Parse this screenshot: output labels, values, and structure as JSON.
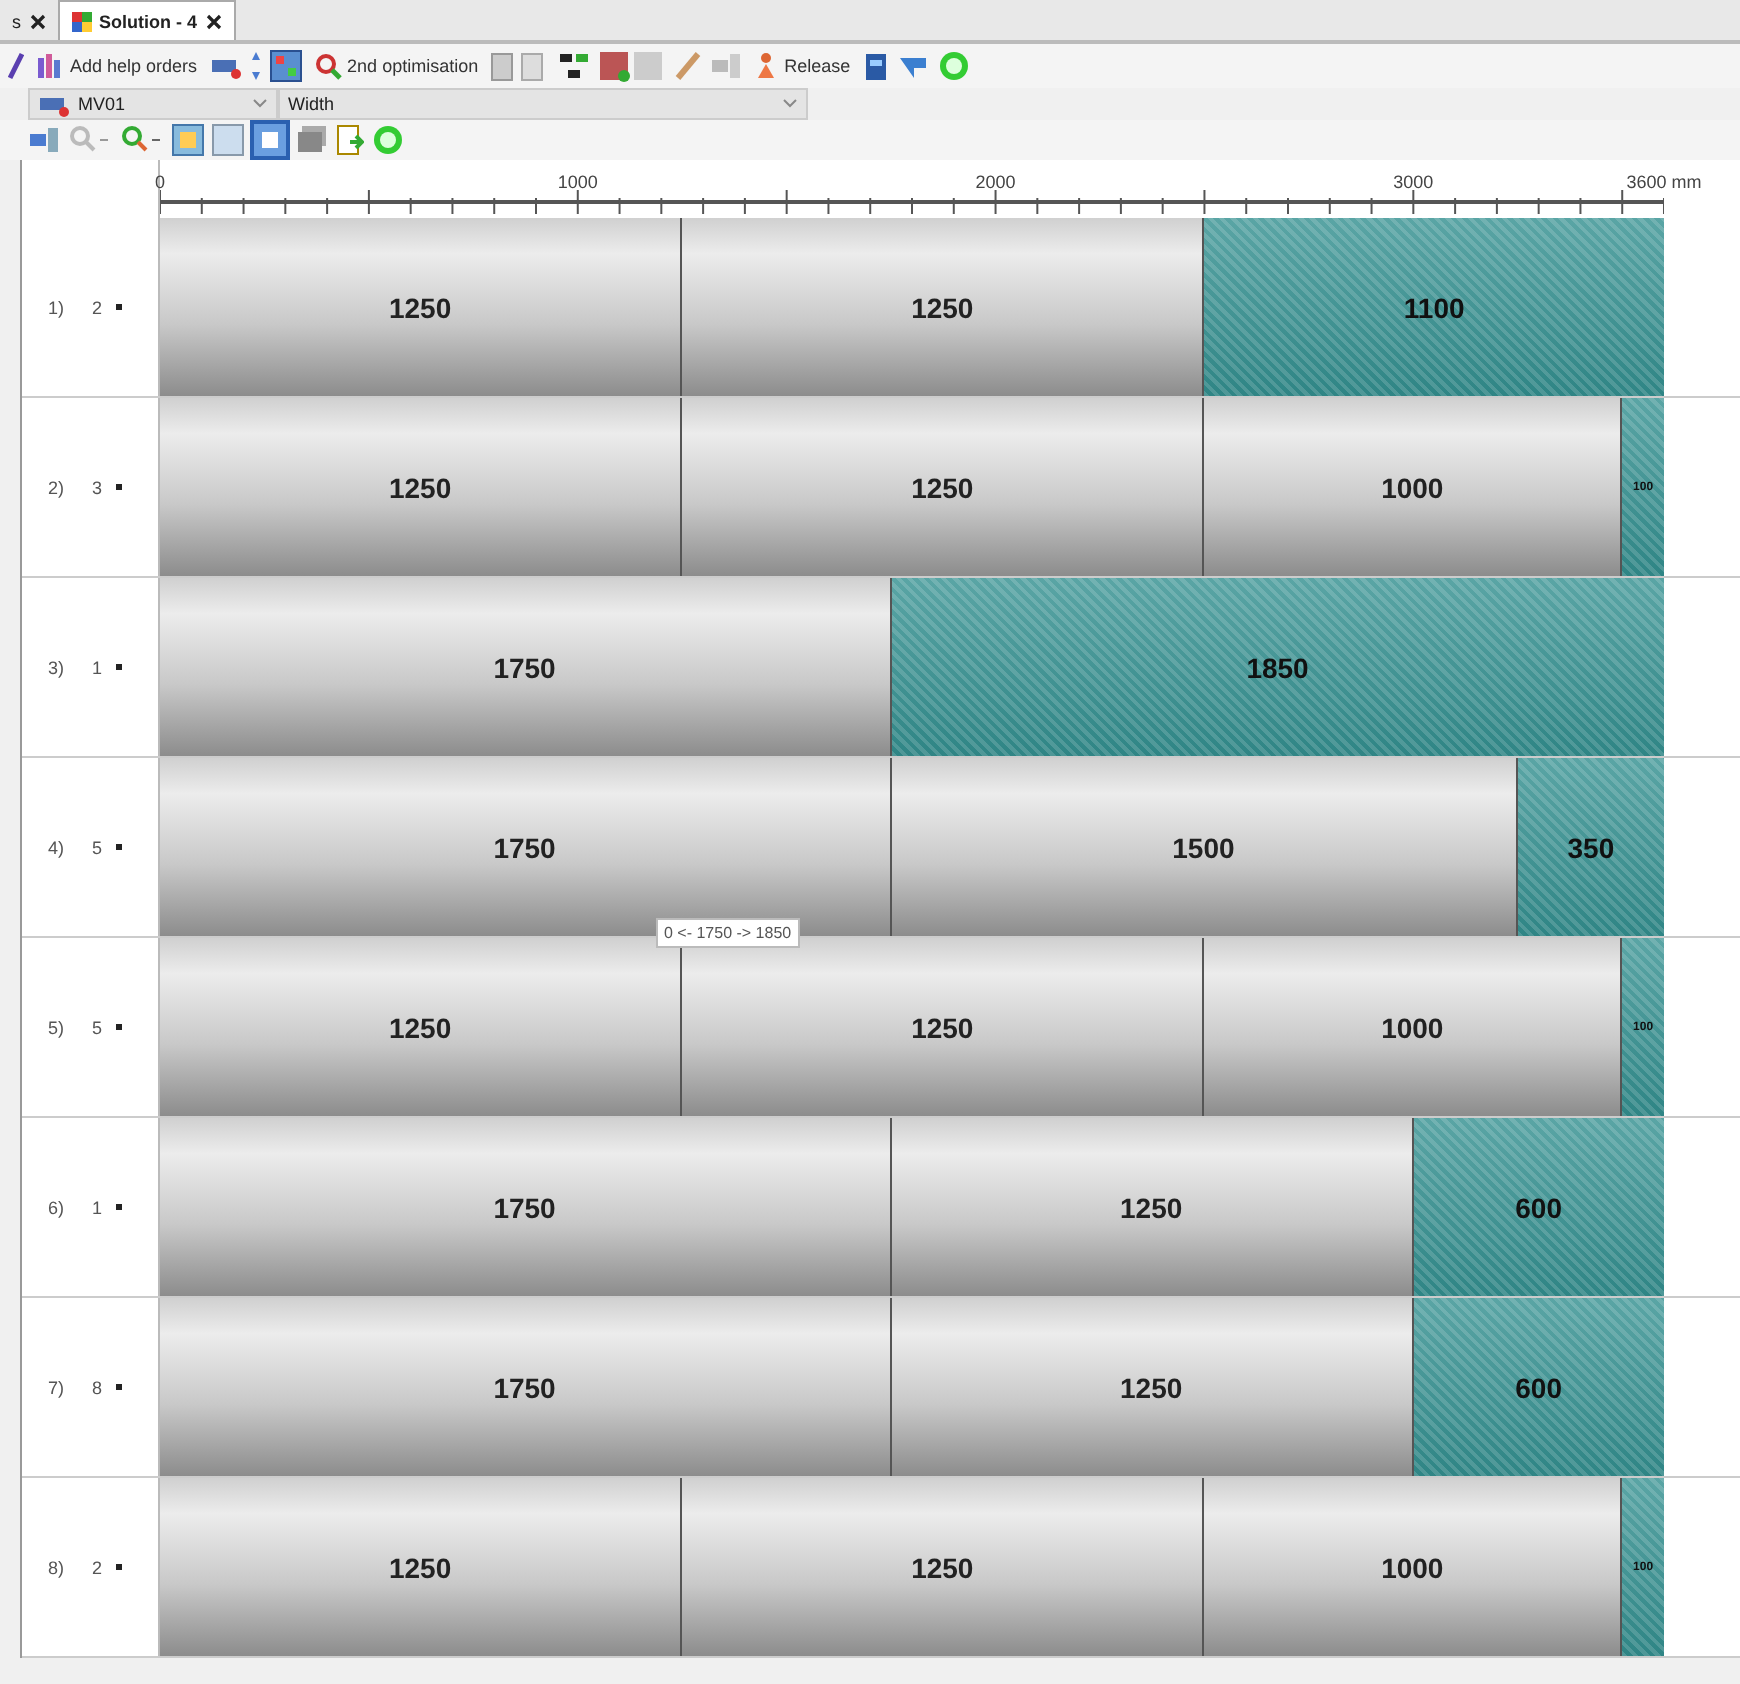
{
  "tabs": [
    {
      "label": "s",
      "selected": false
    },
    {
      "label": "Solution - 4",
      "selected": true
    }
  ],
  "toolbar": {
    "buttons": [
      "Add help orders",
      "2nd optimisation",
      "Release"
    ]
  },
  "selectors": [
    {
      "value": "MV01"
    },
    {
      "value": "Width"
    }
  ],
  "ruler": {
    "labels": [
      "0",
      "1000",
      "2000",
      "3000",
      "3600 mm"
    ]
  },
  "rows": [
    {
      "index": "1)",
      "count": "2",
      "pieces": [
        {
          "kind": "cut",
          "label": "1250"
        },
        {
          "kind": "cut",
          "label": "1250"
        },
        {
          "kind": "rest",
          "label": "1100"
        }
      ]
    },
    {
      "index": "2)",
      "count": "3",
      "pieces": [
        {
          "kind": "cut",
          "label": "1250"
        },
        {
          "kind": "cut",
          "label": "1250"
        },
        {
          "kind": "cut",
          "label": "1000"
        },
        {
          "kind": "rest",
          "label": "100"
        }
      ]
    },
    {
      "index": "3)",
      "count": "1",
      "pieces": [
        {
          "kind": "cut",
          "label": "1750"
        },
        {
          "kind": "rest",
          "label": "1850"
        }
      ]
    },
    {
      "index": "4)",
      "count": "5",
      "pieces": [
        {
          "kind": "cut",
          "label": "1750"
        },
        {
          "kind": "cut",
          "label": "1500"
        },
        {
          "kind": "rest",
          "label": "350"
        }
      ],
      "tooltip": "0 <- 1750 -> 1850"
    },
    {
      "index": "5)",
      "count": "5",
      "pieces": [
        {
          "kind": "cut",
          "label": "1250"
        },
        {
          "kind": "cut",
          "label": "1250"
        },
        {
          "kind": "cut",
          "label": "1000"
        },
        {
          "kind": "rest",
          "label": "100"
        }
      ]
    },
    {
      "index": "6)",
      "count": "1",
      "pieces": [
        {
          "kind": "cut",
          "label": "1750"
        },
        {
          "kind": "cut",
          "label": "1250"
        },
        {
          "kind": "rest",
          "label": "600"
        }
      ]
    },
    {
      "index": "7)",
      "count": "8",
      "pieces": [
        {
          "kind": "cut",
          "label": "1750"
        },
        {
          "kind": "cut",
          "label": "1250"
        },
        {
          "kind": "rest",
          "label": "600"
        }
      ]
    },
    {
      "index": "8)",
      "count": "2",
      "pieces": [
        {
          "kind": "cut",
          "label": "1250"
        },
        {
          "kind": "cut",
          "label": "1250"
        },
        {
          "kind": "cut",
          "label": "1000"
        },
        {
          "kind": "rest",
          "label": "100"
        }
      ]
    }
  ]
}
